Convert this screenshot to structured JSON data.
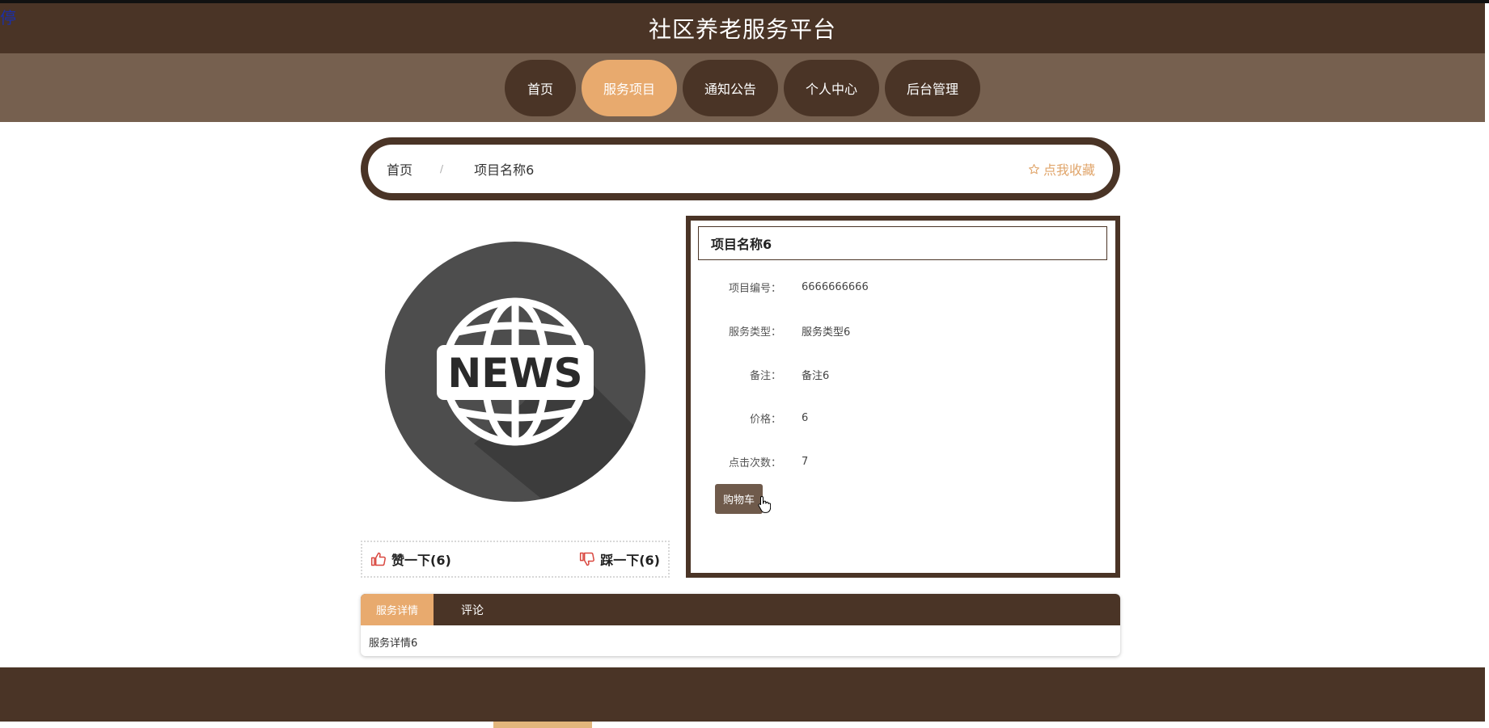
{
  "corner_glyph": "停",
  "header": {
    "title": "社区养老服务平台"
  },
  "nav": {
    "items": [
      {
        "label": "首页"
      },
      {
        "label": "服务项目"
      },
      {
        "label": "通知公告"
      },
      {
        "label": "个人中心"
      },
      {
        "label": "后台管理"
      }
    ],
    "active_index": 1
  },
  "breadcrumb": {
    "home": "首页",
    "separator": "/",
    "current": "项目名称6",
    "favorite_label": "点我收藏"
  },
  "image": {
    "text": "NEWS"
  },
  "votes": {
    "like_label": "赞一下(6)",
    "dislike_label": "踩一下(6)"
  },
  "detail": {
    "title": "项目名称6",
    "fields": [
      {
        "label": "项目编号：",
        "value": "6666666666"
      },
      {
        "label": "服务类型：",
        "value": "服务类型6"
      },
      {
        "label": "备注：",
        "value": "备注6"
      },
      {
        "label": "价格：",
        "value": "6"
      },
      {
        "label": "点击次数：",
        "value": "7"
      }
    ],
    "cart_button": "购物车"
  },
  "tabs": {
    "items": [
      {
        "label": "服务详情"
      },
      {
        "label": "评论"
      }
    ],
    "content": "服务详情6"
  },
  "colors": {
    "primary_brown": "#4a3426",
    "nav_bg": "#76604f",
    "accent_orange": "#e8aa6e",
    "button_brown": "#6f5a4b"
  }
}
